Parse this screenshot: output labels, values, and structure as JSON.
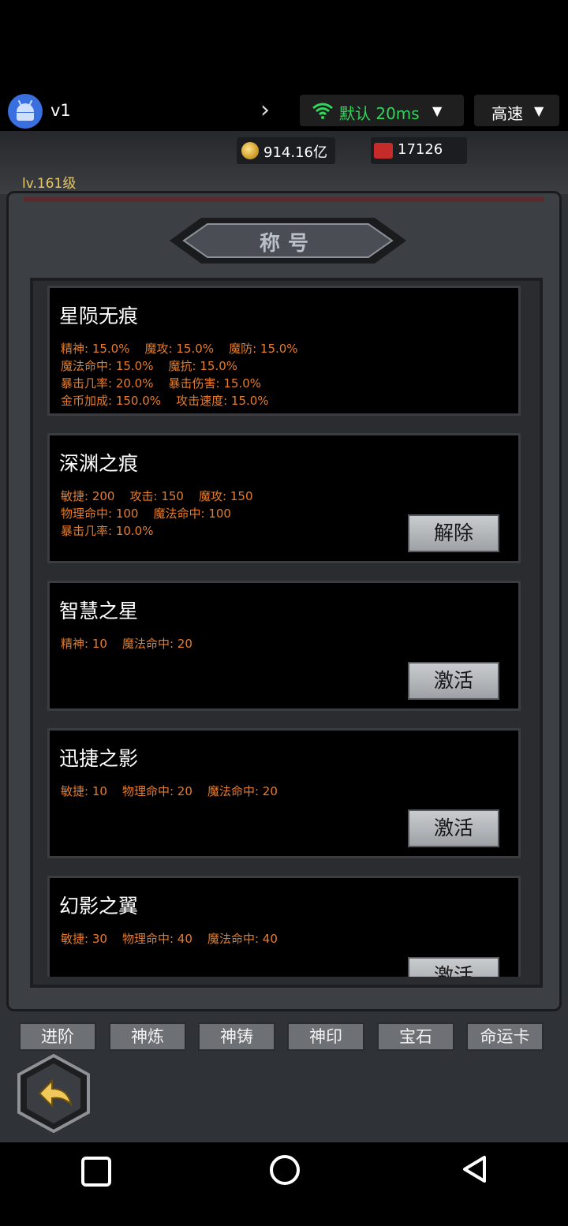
{
  "topbar": {
    "app_name": "v1",
    "network": {
      "label": "默认 20ms",
      "color": "#2fd65a"
    },
    "speed": {
      "label": "高速"
    }
  },
  "resources": {
    "gold": "914.16亿",
    "gems": "17126"
  },
  "level": "lv.161级",
  "panel": {
    "title": "称号"
  },
  "titles": [
    {
      "name": "星陨无痕",
      "stats": [
        "精神: 15.0%    魔攻: 15.0%    魔防: 15.0%",
        "魔法命中: 15.0%    魔抗: 15.0%",
        "暴击几率: 20.0%    暴击伤害: 15.0%",
        "金币加成: 150.0%    攻击速度: 15.0%"
      ],
      "button": ""
    },
    {
      "name": "深渊之痕",
      "stats": [
        "敏捷: 200    攻击: 150    魔攻: 150",
        "物理命中: 100    魔法命中: 100",
        "暴击几率: 10.0%"
      ],
      "button": "解除"
    },
    {
      "name": "智慧之星",
      "stats": [
        "精神: 10    魔法命中: 20"
      ],
      "button": "激活"
    },
    {
      "name": "迅捷之影",
      "stats": [
        "敏捷: 10    物理命中: 20    魔法命中: 20"
      ],
      "button": "激活"
    },
    {
      "name": "幻影之翼",
      "stats": [
        "敏捷: 30    物理命中: 40    魔法命中: 40"
      ],
      "button": "激活"
    }
  ],
  "tabs": [
    "进阶",
    "神炼",
    "神铸",
    "神印",
    "宝石",
    "命运卡"
  ],
  "icons": {
    "app": "android-icon",
    "forward": "chevron-right-icon",
    "wifi": "wifi-icon",
    "caret": "caret-down-icon",
    "gold": "coin-icon",
    "gems": "gem-icon",
    "back": "back-arrow-icon",
    "nav": [
      "recents-square-icon",
      "home-circle-icon",
      "back-triangle-icon"
    ]
  }
}
